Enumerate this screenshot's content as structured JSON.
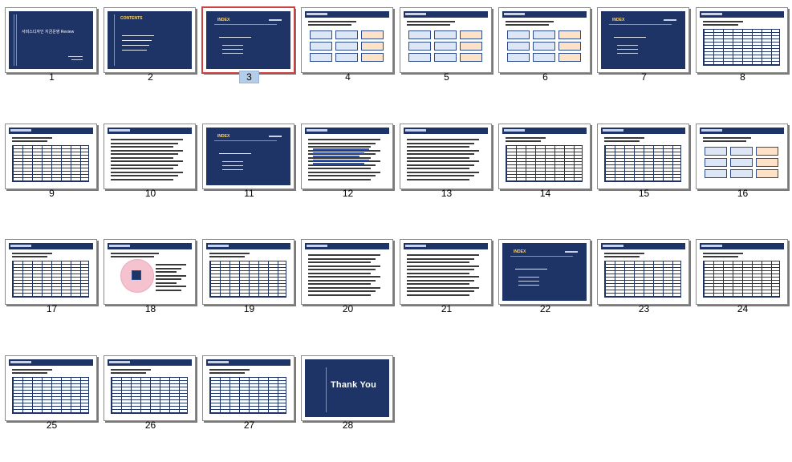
{
  "slides": [
    {
      "number": "1",
      "kind": "title",
      "text": "서비스디자인 지금운영 Review"
    },
    {
      "number": "2",
      "kind": "contents",
      "heading": "CONTENTS"
    },
    {
      "number": "3",
      "kind": "index",
      "heading": "INDEX",
      "selected": true
    },
    {
      "number": "4",
      "kind": "diagram"
    },
    {
      "number": "5",
      "kind": "diagram"
    },
    {
      "number": "6",
      "kind": "diagram"
    },
    {
      "number": "7",
      "kind": "index",
      "heading": "INDEX"
    },
    {
      "number": "8",
      "kind": "table"
    },
    {
      "number": "9",
      "kind": "table"
    },
    {
      "number": "10",
      "kind": "text"
    },
    {
      "number": "11",
      "kind": "index",
      "heading": "INDEX"
    },
    {
      "number": "12",
      "kind": "text"
    },
    {
      "number": "13",
      "kind": "text"
    },
    {
      "number": "14",
      "kind": "table"
    },
    {
      "number": "15",
      "kind": "table"
    },
    {
      "number": "16",
      "kind": "diagram"
    },
    {
      "number": "17",
      "kind": "table"
    },
    {
      "number": "18",
      "kind": "diagram"
    },
    {
      "number": "19",
      "kind": "table"
    },
    {
      "number": "20",
      "kind": "text"
    },
    {
      "number": "21",
      "kind": "text"
    },
    {
      "number": "22",
      "kind": "index",
      "heading": "INDEX"
    },
    {
      "number": "23",
      "kind": "table"
    },
    {
      "number": "24",
      "kind": "table"
    },
    {
      "number": "25",
      "kind": "table"
    },
    {
      "number": "26",
      "kind": "table"
    },
    {
      "number": "27",
      "kind": "table"
    },
    {
      "number": "28",
      "kind": "closing",
      "text": "Thank You"
    }
  ],
  "colors": {
    "navy": "#1e3466",
    "selection": "#b4cde8",
    "selected_border": "#d04040"
  }
}
